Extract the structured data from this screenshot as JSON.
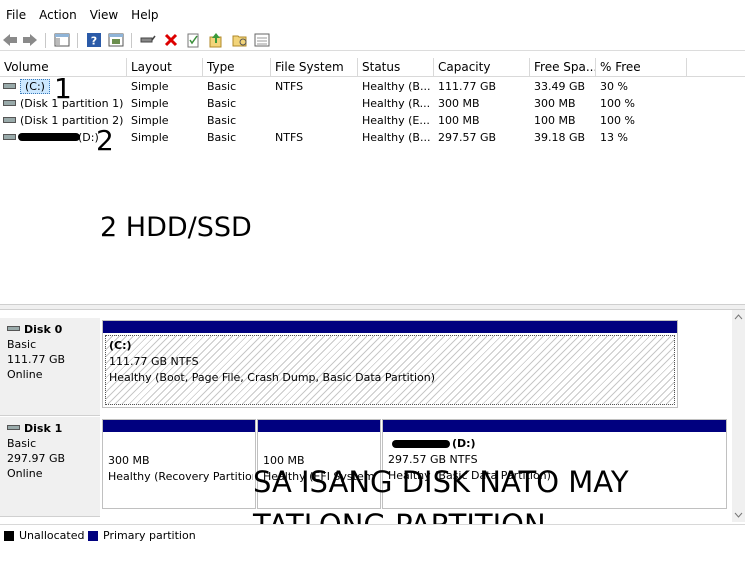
{
  "menu": [
    "File",
    "Action",
    "View",
    "Help"
  ],
  "toolbar_icons": [
    "back-icon",
    "forward-icon",
    "show-hide-tree-icon",
    "help-icon",
    "properties-icon",
    "connect-drive-icon",
    "delete-icon",
    "check-icon",
    "export-icon",
    "open-folder-icon",
    "list-view-icon"
  ],
  "volume_list": {
    "columns": [
      "Volume",
      "Layout",
      "Type",
      "File System",
      "Status",
      "Capacity",
      "Free Spa...",
      "% Free"
    ],
    "rows": [
      {
        "volume": "(C:)",
        "layout": "Simple",
        "type": "Basic",
        "fs": "NTFS",
        "status": "Healthy (B...",
        "capacity": "111.77 GB",
        "free": "33.49 GB",
        "pct": "30 %"
      },
      {
        "volume": "(Disk 1 partition 1)",
        "layout": "Simple",
        "type": "Basic",
        "fs": "",
        "status": "Healthy (R...",
        "capacity": "300 MB",
        "free": "300 MB",
        "pct": "100 %"
      },
      {
        "volume": "(Disk 1 partition 2)",
        "layout": "Simple",
        "type": "Basic",
        "fs": "",
        "status": "Healthy (E...",
        "capacity": "100 MB",
        "free": "100 MB",
        "pct": "100 %"
      },
      {
        "volume": "(D:)",
        "layout": "Simple",
        "type": "Basic",
        "fs": "NTFS",
        "status": "Healthy (B...",
        "capacity": "297.57 GB",
        "free": "39.18 GB",
        "pct": "13 %"
      }
    ]
  },
  "disks": [
    {
      "name": "Disk 0",
      "type": "Basic",
      "size": "111.77 GB",
      "state": "Online",
      "partitions": [
        {
          "title": "(C:)",
          "size": "111.77 GB NTFS",
          "status": "Healthy (Boot, Page File, Crash Dump, Basic Data Partition)"
        }
      ]
    },
    {
      "name": "Disk 1",
      "type": "Basic",
      "size": "297.97 GB",
      "state": "Online",
      "partitions": [
        {
          "title": "",
          "size": "300 MB",
          "status": "Healthy (Recovery Partition)"
        },
        {
          "title": "",
          "size": "100 MB",
          "status": "Healthy (EFI System Partition)"
        },
        {
          "title": "(D:)",
          "size": "297.57 GB NTFS",
          "status": "Healthy (Basic Data Partition)"
        }
      ]
    }
  ],
  "legend": [
    {
      "label": "Unallocated",
      "color": "#000000"
    },
    {
      "label": "Primary partition",
      "color": "#00007f"
    }
  ],
  "annotations": {
    "num1": "1",
    "num2": "2",
    "hdd": "2 HDD/SSD",
    "line1": "SA ISANG DISK NATO MAY",
    "line2": "TATLONG  PARTITION"
  },
  "colors": {
    "partition_bar": "#00007f",
    "selection": "#cce8ff"
  }
}
